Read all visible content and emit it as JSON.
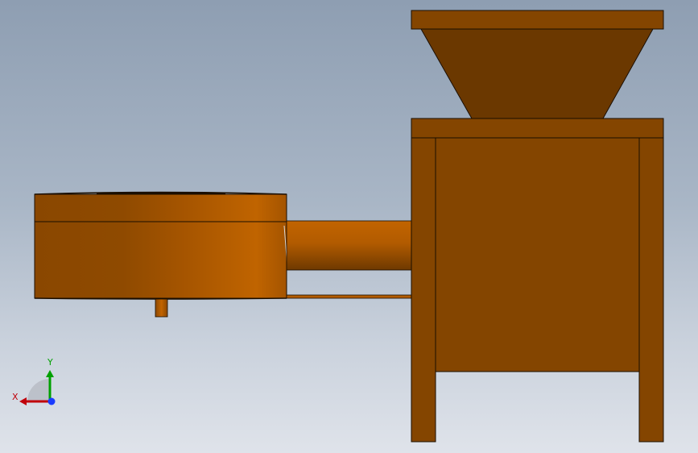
{
  "viewport": {
    "background_top": "#8e9eb2",
    "background_bottom": "#dfe3ea"
  },
  "model": {
    "colors": {
      "part_dark": "#6b3800",
      "part_mid": "#844500",
      "part_light": "#b85e00",
      "edge": "#1a0e00"
    }
  },
  "triad": {
    "x_label": "X",
    "y_label": "Y",
    "x_color": "#c0000a",
    "y_color": "#00a000",
    "z_color": "#1a3cff"
  }
}
